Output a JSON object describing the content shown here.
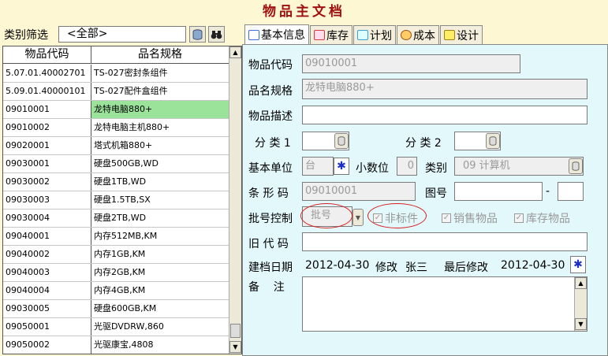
{
  "title": "物品主文档",
  "filter": {
    "label": "类别筛选",
    "value": "<全部>"
  },
  "grid": {
    "headers": [
      "物品代码",
      "品名规格"
    ],
    "rows": [
      [
        "5.07.01.40002701",
        "TS-027密封条组件"
      ],
      [
        "5.09.01.40000101",
        "TS-027配件盒组件"
      ],
      [
        "09010001",
        "龙特电脑880+"
      ],
      [
        "09010002",
        "龙特电脑主机880+"
      ],
      [
        "09020001",
        "塔式机箱880+"
      ],
      [
        "09030001",
        "硬盘500GB,WD"
      ],
      [
        "09030002",
        "硬盘1TB,WD"
      ],
      [
        "09030003",
        "硬盘1.5TB,SX"
      ],
      [
        "09030004",
        "硬盘2TB,WD"
      ],
      [
        "09040001",
        "内存512MB,KM"
      ],
      [
        "09040002",
        "内存1GB,KM"
      ],
      [
        "09040003",
        "内存2GB,KM"
      ],
      [
        "09040004",
        "内存4GB,KM"
      ],
      [
        "09030005",
        "硬盘600GB,KM"
      ],
      [
        "09050001",
        "光驱DVDRW,860"
      ],
      [
        "09050002",
        "光驱康宝,4808"
      ]
    ]
  },
  "tabs": [
    {
      "label": "基本信息",
      "icon": "edit-doc-icon",
      "color": "#3a6fd8"
    },
    {
      "label": "库存",
      "icon": "pencil-icon",
      "color": "#d83a3a"
    },
    {
      "label": "计划",
      "icon": "chart-icon",
      "color": "#3aa0d8"
    },
    {
      "label": "成本",
      "icon": "coin-icon",
      "color": "#d8a020"
    },
    {
      "label": "设计",
      "icon": "folder-icon",
      "color": "#e8c020"
    }
  ],
  "form": {
    "code_label": "物品代码",
    "code_value": "09010001",
    "name_label": "品名规格",
    "name_value": "龙特电脑880+",
    "desc_label": "物品描述",
    "desc_value": "",
    "cat1_label": "分 类 1",
    "cat2_label": "分 类 2",
    "unit_label": "基本单位",
    "unit_value": "台",
    "decimal_label": "小数位",
    "decimal_value": "0",
    "type_label": "类别",
    "type_value": "09 计算机",
    "barcode_label": "条 形 码",
    "barcode_value": "09010001",
    "drawing_label": "图号",
    "drawing_sep": "-",
    "batch_label": "批号控制",
    "batch_value": "批号",
    "nonstd_label": "非标件",
    "sales_label": "销售物品",
    "stock_label": "库存物品",
    "oldcode_label": "旧 代 码",
    "created_label": "建档日期",
    "created_value": "2012-04-30",
    "modifier_label": "修改",
    "modifier_value": "张三",
    "lastmod_label": "最后修改",
    "lastmod_value": "2012-04-30",
    "note_label": "备    注"
  },
  "colors": {
    "accent": "#a01010",
    "panel": "#e3f8fb",
    "selected": "#9be29b",
    "annotation": "#d82020"
  }
}
